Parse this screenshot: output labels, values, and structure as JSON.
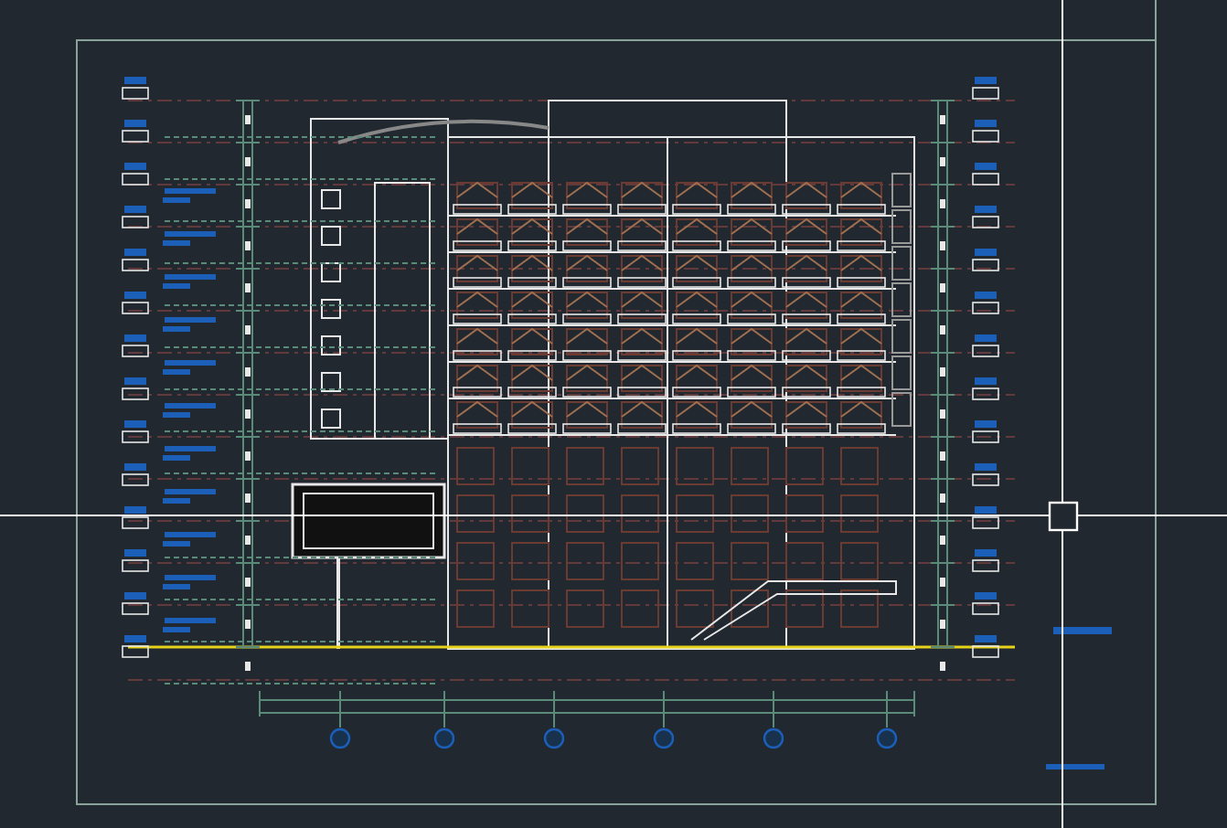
{
  "cad_view": {
    "cursor_visible": true
  }
}
